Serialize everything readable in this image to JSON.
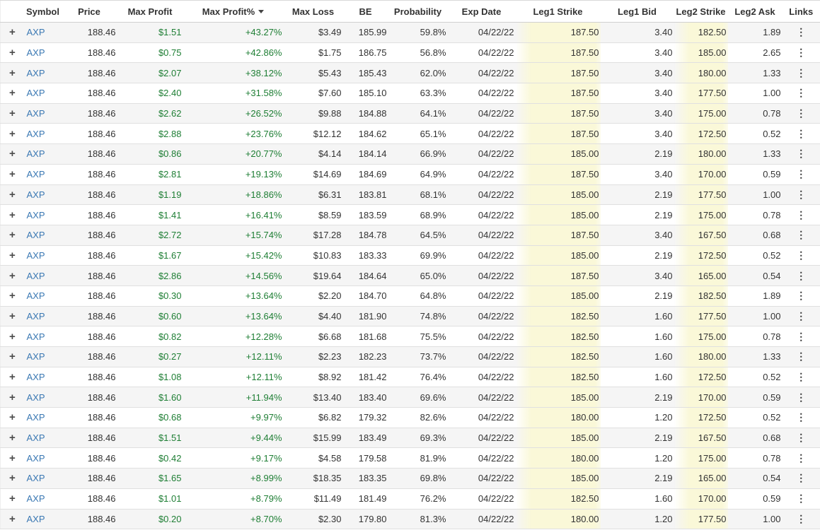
{
  "screener": {
    "columns": [
      {
        "key": "expand",
        "label": ""
      },
      {
        "key": "symbol",
        "label": "Symbol"
      },
      {
        "key": "price",
        "label": "Price"
      },
      {
        "key": "max_profit",
        "label": "Max Profit",
        "color": "green"
      },
      {
        "key": "max_profit_pct",
        "label": "Max Profit%",
        "color": "green",
        "sorted": "desc"
      },
      {
        "key": "max_loss",
        "label": "Max Loss"
      },
      {
        "key": "be",
        "label": "BE"
      },
      {
        "key": "probability",
        "label": "Probability"
      },
      {
        "key": "exp_date",
        "label": "Exp Date"
      },
      {
        "key": "leg1_strike",
        "label": "Leg1 Strike",
        "highlight": true
      },
      {
        "key": "leg1_bid",
        "label": "Leg1 Bid"
      },
      {
        "key": "leg2_strike",
        "label": "Leg2 Strike",
        "highlight": true
      },
      {
        "key": "leg2_ask",
        "label": "Leg2 Ask"
      },
      {
        "key": "links",
        "label": "Links"
      }
    ],
    "icons": {
      "expand": "+",
      "sort_desc": "triangle-down",
      "links": "⋮"
    },
    "row_fields": [
      "symbol",
      "price",
      "max_profit",
      "max_profit_pct",
      "max_loss",
      "be",
      "probability",
      "exp_date",
      "leg1_strike",
      "leg1_bid",
      "leg2_strike",
      "leg2_ask"
    ],
    "rows": [
      [
        "AXP",
        "188.46",
        "$1.51",
        "+43.27%",
        "$3.49",
        "185.99",
        "59.8%",
        "04/22/22",
        "187.50",
        "3.40",
        "182.50",
        "1.89"
      ],
      [
        "AXP",
        "188.46",
        "$0.75",
        "+42.86%",
        "$1.75",
        "186.75",
        "56.8%",
        "04/22/22",
        "187.50",
        "3.40",
        "185.00",
        "2.65"
      ],
      [
        "AXP",
        "188.46",
        "$2.07",
        "+38.12%",
        "$5.43",
        "185.43",
        "62.0%",
        "04/22/22",
        "187.50",
        "3.40",
        "180.00",
        "1.33"
      ],
      [
        "AXP",
        "188.46",
        "$2.40",
        "+31.58%",
        "$7.60",
        "185.10",
        "63.3%",
        "04/22/22",
        "187.50",
        "3.40",
        "177.50",
        "1.00"
      ],
      [
        "AXP",
        "188.46",
        "$2.62",
        "+26.52%",
        "$9.88",
        "184.88",
        "64.1%",
        "04/22/22",
        "187.50",
        "3.40",
        "175.00",
        "0.78"
      ],
      [
        "AXP",
        "188.46",
        "$2.88",
        "+23.76%",
        "$12.12",
        "184.62",
        "65.1%",
        "04/22/22",
        "187.50",
        "3.40",
        "172.50",
        "0.52"
      ],
      [
        "AXP",
        "188.46",
        "$0.86",
        "+20.77%",
        "$4.14",
        "184.14",
        "66.9%",
        "04/22/22",
        "185.00",
        "2.19",
        "180.00",
        "1.33"
      ],
      [
        "AXP",
        "188.46",
        "$2.81",
        "+19.13%",
        "$14.69",
        "184.69",
        "64.9%",
        "04/22/22",
        "187.50",
        "3.40",
        "170.00",
        "0.59"
      ],
      [
        "AXP",
        "188.46",
        "$1.19",
        "+18.86%",
        "$6.31",
        "183.81",
        "68.1%",
        "04/22/22",
        "185.00",
        "2.19",
        "177.50",
        "1.00"
      ],
      [
        "AXP",
        "188.46",
        "$1.41",
        "+16.41%",
        "$8.59",
        "183.59",
        "68.9%",
        "04/22/22",
        "185.00",
        "2.19",
        "175.00",
        "0.78"
      ],
      [
        "AXP",
        "188.46",
        "$2.72",
        "+15.74%",
        "$17.28",
        "184.78",
        "64.5%",
        "04/22/22",
        "187.50",
        "3.40",
        "167.50",
        "0.68"
      ],
      [
        "AXP",
        "188.46",
        "$1.67",
        "+15.42%",
        "$10.83",
        "183.33",
        "69.9%",
        "04/22/22",
        "185.00",
        "2.19",
        "172.50",
        "0.52"
      ],
      [
        "AXP",
        "188.46",
        "$2.86",
        "+14.56%",
        "$19.64",
        "184.64",
        "65.0%",
        "04/22/22",
        "187.50",
        "3.40",
        "165.00",
        "0.54"
      ],
      [
        "AXP",
        "188.46",
        "$0.30",
        "+13.64%",
        "$2.20",
        "184.70",
        "64.8%",
        "04/22/22",
        "185.00",
        "2.19",
        "182.50",
        "1.89"
      ],
      [
        "AXP",
        "188.46",
        "$0.60",
        "+13.64%",
        "$4.40",
        "181.90",
        "74.8%",
        "04/22/22",
        "182.50",
        "1.60",
        "177.50",
        "1.00"
      ],
      [
        "AXP",
        "188.46",
        "$0.82",
        "+12.28%",
        "$6.68",
        "181.68",
        "75.5%",
        "04/22/22",
        "182.50",
        "1.60",
        "175.00",
        "0.78"
      ],
      [
        "AXP",
        "188.46",
        "$0.27",
        "+12.11%",
        "$2.23",
        "182.23",
        "73.7%",
        "04/22/22",
        "182.50",
        "1.60",
        "180.00",
        "1.33"
      ],
      [
        "AXP",
        "188.46",
        "$1.08",
        "+12.11%",
        "$8.92",
        "181.42",
        "76.4%",
        "04/22/22",
        "182.50",
        "1.60",
        "172.50",
        "0.52"
      ],
      [
        "AXP",
        "188.46",
        "$1.60",
        "+11.94%",
        "$13.40",
        "183.40",
        "69.6%",
        "04/22/22",
        "185.00",
        "2.19",
        "170.00",
        "0.59"
      ],
      [
        "AXP",
        "188.46",
        "$0.68",
        "+9.97%",
        "$6.82",
        "179.32",
        "82.6%",
        "04/22/22",
        "180.00",
        "1.20",
        "172.50",
        "0.52"
      ],
      [
        "AXP",
        "188.46",
        "$1.51",
        "+9.44%",
        "$15.99",
        "183.49",
        "69.3%",
        "04/22/22",
        "185.00",
        "2.19",
        "167.50",
        "0.68"
      ],
      [
        "AXP",
        "188.46",
        "$0.42",
        "+9.17%",
        "$4.58",
        "179.58",
        "81.9%",
        "04/22/22",
        "180.00",
        "1.20",
        "175.00",
        "0.78"
      ],
      [
        "AXP",
        "188.46",
        "$1.65",
        "+8.99%",
        "$18.35",
        "183.35",
        "69.8%",
        "04/22/22",
        "185.00",
        "2.19",
        "165.00",
        "0.54"
      ],
      [
        "AXP",
        "188.46",
        "$1.01",
        "+8.79%",
        "$11.49",
        "181.49",
        "76.2%",
        "04/22/22",
        "182.50",
        "1.60",
        "170.00",
        "0.59"
      ],
      [
        "AXP",
        "188.46",
        "$0.20",
        "+8.70%",
        "$2.30",
        "179.80",
        "81.3%",
        "04/22/22",
        "180.00",
        "1.20",
        "177.50",
        "1.00"
      ]
    ]
  },
  "colors": {
    "link_blue": "#3a78b3",
    "profit_green": "#1e7e34",
    "highlight_yellow": "#faf8d8",
    "stripe_gray": "#f5f5f5",
    "row_border": "#e0e0e0",
    "header_text": "#333333",
    "body_text": "#333333",
    "icon_dark": "#4a4a4a"
  }
}
